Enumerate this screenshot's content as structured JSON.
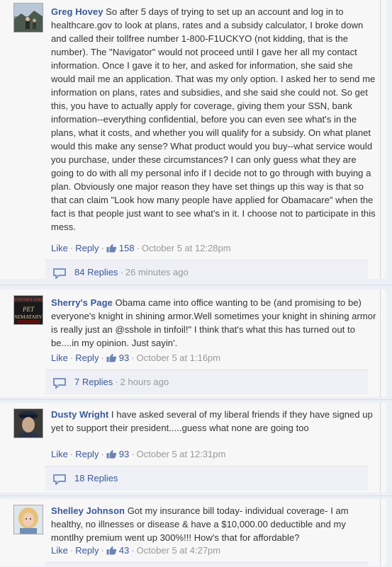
{
  "comments": [
    {
      "author": "Greg Hovey",
      "text": "So after 5 days of trying to set up an account and log in to healthcare.gov to look at plans, rates and a subsidy calculator, I broke down and called their tollfree number 1-800-F1UCKYO (not kidding, that is the number). The \"Navigator\" would not proceed until I gave her all my contact information. Once I gave it to her, and asked for information, she said she would mail me an application. That was my only option. I asked her to send me information on plans, rates and subsidies, and she said she could not. So get this, you have to actually apply for coverage, giving them your SSN, bank information--everything confidential, before you can even see what's in the plans, what it costs, and whether you will qualify for a subsidy. On what planet would this make any sense? What product would you buy--what service would you purchase, under these circumstances? I can only guess what they are going to do with all my personal info if I decide not to go through with buying a plan. Obviously one major reason they have set things up this way is that so that can claim \"Look how many people have applied for Obamacare\" when the fact is that people just want to see what's in it. I choose not to participate in this mess.",
      "like_label": "Like",
      "reply_label": "Reply",
      "likes": "158",
      "timestamp": "October 5 at 12:28pm",
      "replies_label": "84 Replies",
      "replies_time": "26 minutes ago"
    },
    {
      "author": "Sherry's Page",
      "text": "Obama came into office wanting to be (and promising to be) everyone's knight in shining armor.Well sometimes your knight in shining armor is really just an @sshole in tinfoil!\" I think that's what this has turned out to be....in my opinion. Just sayin'.",
      "like_label": "Like",
      "reply_label": "Reply",
      "likes": "93",
      "timestamp": "October 5 at 1:16pm",
      "replies_label": "7 Replies",
      "replies_time": "2 hours ago",
      "avatar_text": "STEPHEN KING PET SEMATARY"
    },
    {
      "author": "Dusty Wright",
      "text": "I have asked several of my liberal friends if they have signed up yet to support their president.....guess what none are going too",
      "like_label": "Like",
      "reply_label": "Reply",
      "likes": "93",
      "timestamp": "October 5 at 12:31pm",
      "replies_label": "18 Replies",
      "replies_time": ""
    },
    {
      "author": "Shelley Johnson",
      "text": "Got my insurance bill today- individual coverage- I am healthy, no illnesses or disease & have a $10,000.00 deductible and my montlhy premium went up 300%!!! How's that for affordable?",
      "like_label": "Like",
      "reply_label": "Reply",
      "likes": "43",
      "timestamp": "October 5 at 4:27pm"
    }
  ],
  "colors": {
    "link": "#3b5998",
    "muted": "#999999",
    "background": "#eceff5",
    "comment_bg": "#f7f7f7"
  }
}
